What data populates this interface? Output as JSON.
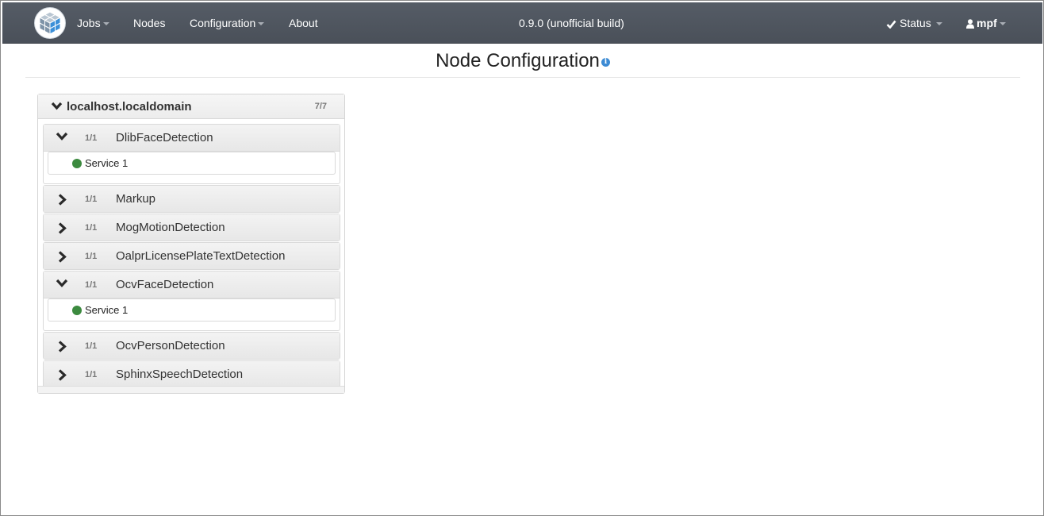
{
  "navbar": {
    "menu": [
      {
        "label": "Jobs",
        "dropdown": true
      },
      {
        "label": "Nodes",
        "dropdown": false
      },
      {
        "label": "Configuration",
        "dropdown": true
      },
      {
        "label": "About",
        "dropdown": false
      }
    ],
    "version": "0.9.0 (unofficial build)",
    "status_label": "Status",
    "user_label": "mpf",
    "background_color": "#4f555e"
  },
  "page": {
    "title": "Node Configuration",
    "info_icon": "info-circle-icon"
  },
  "node": {
    "name": "localhost.localdomain",
    "count": "7/7",
    "expanded": true,
    "services": [
      {
        "name": "DlibFaceDetection",
        "count": "1/1",
        "expanded": true,
        "instances": [
          {
            "label": "Service 1",
            "status_color": "#3c8a3f"
          }
        ]
      },
      {
        "name": "Markup",
        "count": "1/1",
        "expanded": false,
        "instances": []
      },
      {
        "name": "MogMotionDetection",
        "count": "1/1",
        "expanded": false,
        "instances": []
      },
      {
        "name": "OalprLicensePlateTextDetection",
        "count": "1/1",
        "expanded": false,
        "instances": []
      },
      {
        "name": "OcvFaceDetection",
        "count": "1/1",
        "expanded": true,
        "instances": [
          {
            "label": "Service 1",
            "status_color": "#3c8a3f"
          }
        ]
      },
      {
        "name": "OcvPersonDetection",
        "count": "1/1",
        "expanded": false,
        "instances": []
      },
      {
        "name": "SphinxSpeechDetection",
        "count": "1/1",
        "expanded": false,
        "instances": []
      }
    ]
  }
}
